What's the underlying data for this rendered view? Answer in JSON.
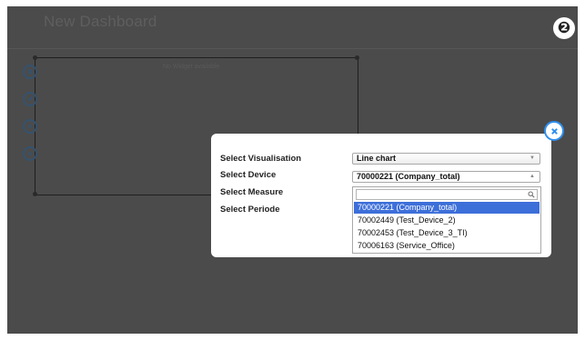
{
  "dashboard": {
    "title": "New Dashboard",
    "widget_label": "No Widget available"
  },
  "step_badge": "❷",
  "side_toolbar": [
    {
      "name": "close-icon",
      "glyph": "x"
    },
    {
      "name": "pencil-icon",
      "glyph": "edit"
    },
    {
      "name": "chevron-up-icon",
      "glyph": "up"
    },
    {
      "name": "chevron-down-icon",
      "glyph": "down"
    }
  ],
  "modal": {
    "labels": {
      "visualisation": "Select Visualisation",
      "device": "Select Device",
      "measure": "Select Measure",
      "periode": "Select Periode"
    },
    "visualisation_value": "Line chart",
    "device_value": "70000221 (Company_total)",
    "search_placeholder": "",
    "device_options": [
      "70000221 (Company_total)",
      "70002449 (Test_Device_2)",
      "70002453 (Test_Device_3_TI)",
      "70006163 (Service_Office)"
    ],
    "selected_index": 0
  },
  "colors": {
    "overlay": "#4b4b4b",
    "accent_blue": "#2f8ff0",
    "selected_option": "#3d6fd9"
  }
}
